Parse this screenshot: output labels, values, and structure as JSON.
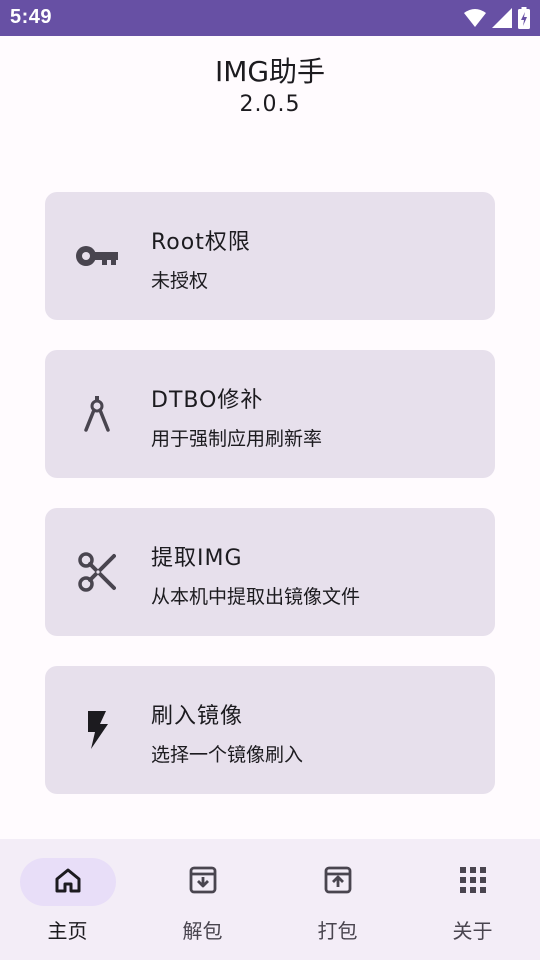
{
  "status_bar": {
    "time": "5:49",
    "background": "#6750a4",
    "icons": [
      "wifi-icon",
      "signal-icon",
      "battery-charging-icon"
    ]
  },
  "header": {
    "title": "IMG助手",
    "version": "2.0.5"
  },
  "cards": [
    {
      "icon": "key-icon",
      "title": "Root权限",
      "subtitle": "未授权"
    },
    {
      "icon": "compass-tool-icon",
      "title": "DTBO修补",
      "subtitle": "用于强制应用刷新率"
    },
    {
      "icon": "scissors-icon",
      "title": "提取IMG",
      "subtitle": "从本机中提取出镜像文件"
    },
    {
      "icon": "flash-icon",
      "title": "刷入镜像",
      "subtitle": "选择一个镜像刷入"
    }
  ],
  "bottom_nav": {
    "active_index": 0,
    "items": [
      {
        "icon": "home-icon",
        "label": "主页"
      },
      {
        "icon": "archive-download-icon",
        "label": "解包"
      },
      {
        "icon": "archive-upload-icon",
        "label": "打包"
      },
      {
        "icon": "apps-grid-icon",
        "label": "关于"
      }
    ]
  },
  "colors": {
    "card_background": "#e7e0ec",
    "nav_background": "#f3edf7",
    "nav_active_indicator": "#e8def8",
    "page_background": "#fffbfe"
  }
}
